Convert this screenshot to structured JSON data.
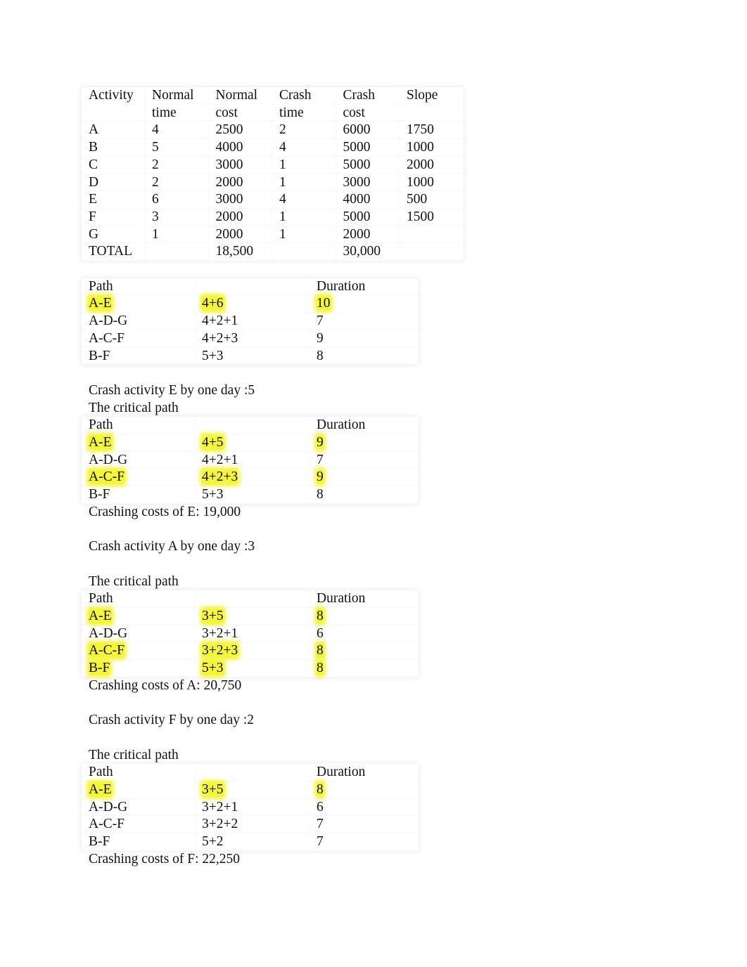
{
  "activity_table": {
    "headers": [
      [
        "Activity",
        ""
      ],
      [
        "Normal",
        "time"
      ],
      [
        "Normal",
        "cost"
      ],
      [
        "Crash",
        "time"
      ],
      [
        "Crash",
        "cost"
      ],
      [
        "Slope",
        ""
      ]
    ],
    "rows": [
      [
        "A",
        "4",
        "2500",
        "2",
        "6000",
        "1750"
      ],
      [
        "B",
        "5",
        "4000",
        "4",
        "5000",
        "1000"
      ],
      [
        "C",
        "2",
        "3000",
        "1",
        "5000",
        "2000"
      ],
      [
        "D",
        "2",
        "2000",
        "1",
        "3000",
        "1000"
      ],
      [
        "E",
        "6",
        "3000",
        "4",
        "4000",
        "500"
      ],
      [
        "F",
        "3",
        "2000",
        "1",
        "5000",
        "1500"
      ],
      [
        "G",
        "1",
        "2000",
        "1",
        "2000",
        ""
      ],
      [
        "TOTAL",
        "",
        "18,500",
        "",
        "30,000",
        ""
      ]
    ]
  },
  "highlight_color": "#f4f53c",
  "sections": [
    {
      "intro": [],
      "headers": [
        "Path",
        "",
        "Duration"
      ],
      "rows": [
        {
          "cells": [
            "A-E",
            "4+6",
            "10"
          ],
          "highlight": true
        },
        {
          "cells": [
            "A-D-G",
            "4+2+1",
            "7"
          ],
          "highlight": false
        },
        {
          "cells": [
            "A-C-F",
            "4+2+3",
            "9"
          ],
          "highlight": false
        },
        {
          "cells": [
            "B-F",
            "5+3",
            "8"
          ],
          "highlight": false
        }
      ],
      "footer": ""
    },
    {
      "intro": [
        "Crash activity E by one day :5",
        "The critical path"
      ],
      "headers": [
        "Path",
        "",
        "Duration"
      ],
      "rows": [
        {
          "cells": [
            "A-E",
            "4+5",
            "9"
          ],
          "highlight": true
        },
        {
          "cells": [
            "A-D-G",
            "4+2+1",
            "7"
          ],
          "highlight": false
        },
        {
          "cells": [
            "A-C-F",
            "4+2+3",
            "9"
          ],
          "highlight": true
        },
        {
          "cells": [
            "B-F",
            "5+3",
            "8"
          ],
          "highlight": false
        }
      ],
      "footer": "Crashing costs of E: 19,000"
    },
    {
      "intro": [
        "Crash activity A by one day :3",
        "",
        "The critical path"
      ],
      "headers": [
        "Path",
        "",
        "Duration"
      ],
      "rows": [
        {
          "cells": [
            "A-E",
            "3+5",
            "8"
          ],
          "highlight": true
        },
        {
          "cells": [
            "A-D-G",
            "3+2+1",
            "6"
          ],
          "highlight": false
        },
        {
          "cells": [
            "A-C-F",
            "3+2+3",
            "8"
          ],
          "highlight": true
        },
        {
          "cells": [
            "B-F",
            "5+3",
            "8"
          ],
          "highlight": true
        }
      ],
      "footer": "Crashing costs of A: 20,750"
    },
    {
      "intro": [
        "Crash activity F by one day :2",
        "",
        "The critical path"
      ],
      "headers": [
        "Path",
        "",
        "Duration"
      ],
      "rows": [
        {
          "cells": [
            "A-E",
            "3+5",
            "8"
          ],
          "highlight": true
        },
        {
          "cells": [
            "A-D-G",
            "3+2+1",
            "6"
          ],
          "highlight": false
        },
        {
          "cells": [
            "A-C-F",
            "3+2+2",
            "7"
          ],
          "highlight": false
        },
        {
          "cells": [
            "B-F",
            "5+2",
            "7"
          ],
          "highlight": false
        }
      ],
      "footer": "Crashing costs of F: 22,250"
    }
  ]
}
